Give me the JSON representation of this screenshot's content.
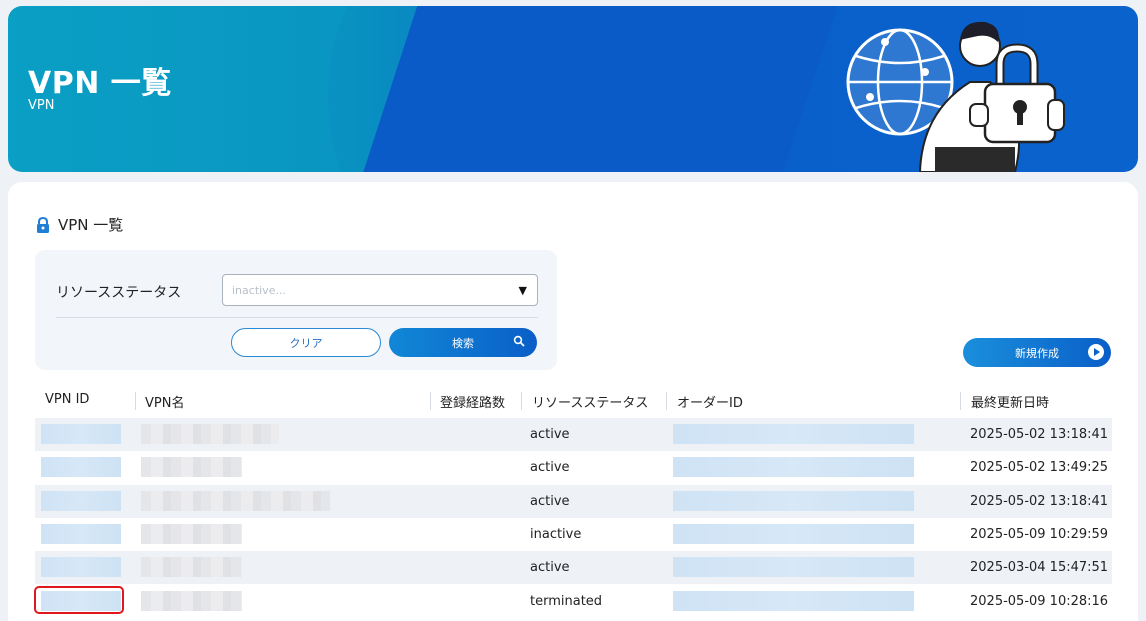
{
  "banner": {
    "title": "VPN 一覧",
    "subtitle": "VPN"
  },
  "section": {
    "title": "VPN 一覧",
    "icon": "lock-icon"
  },
  "filter": {
    "status_label": "リソースステータス",
    "status_placeholder": "inactive...",
    "clear_label": "クリア",
    "search_label": "検索"
  },
  "actions": {
    "new_label": "新規作成"
  },
  "table": {
    "headers": [
      "VPN ID",
      "VPN名",
      "登録経路数",
      "リソースステータス",
      "オーダーID",
      "最終更新日時"
    ],
    "rows": [
      {
        "status": "active",
        "updated": "2025-05-02 13:18:41"
      },
      {
        "status": "active",
        "updated": "2025-05-02 13:49:25"
      },
      {
        "status": "active",
        "updated": "2025-05-02 13:18:41"
      },
      {
        "status": "inactive",
        "updated": "2025-05-09 10:29:59"
      },
      {
        "status": "active",
        "updated": "2025-03-04 15:47:51"
      },
      {
        "status": "terminated",
        "updated": "2025-05-09 10:28:16"
      }
    ]
  },
  "colors": {
    "accent": "#0a62cc",
    "highlight": "#e0181b"
  }
}
